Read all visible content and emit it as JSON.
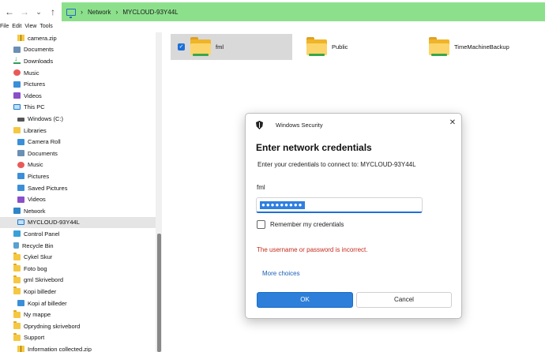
{
  "address": {
    "segments": [
      "Network",
      "MYCLOUD-93Y44L"
    ]
  },
  "menu": [
    "File",
    "Edit",
    "View",
    "Tools"
  ],
  "sidebar": {
    "items": [
      {
        "label": "camera.zip",
        "icon": "zip-icon"
      },
      {
        "label": "Documents",
        "icon": "documents-icon"
      },
      {
        "label": "Downloads",
        "icon": "downloads-icon"
      },
      {
        "label": "Music",
        "icon": "music-icon"
      },
      {
        "label": "Pictures",
        "icon": "pictures-icon"
      },
      {
        "label": "Videos",
        "icon": "videos-icon"
      },
      {
        "label": "This PC",
        "icon": "pc-icon"
      },
      {
        "label": "Windows (C:)",
        "icon": "drive-icon"
      },
      {
        "label": "Libraries",
        "icon": "libraries-icon"
      },
      {
        "label": "Camera Roll",
        "icon": "pictures-icon"
      },
      {
        "label": "Documents",
        "icon": "documents-icon"
      },
      {
        "label": "Music",
        "icon": "music-icon"
      },
      {
        "label": "Pictures",
        "icon": "pictures-icon"
      },
      {
        "label": "Saved Pictures",
        "icon": "pictures-icon"
      },
      {
        "label": "Videos",
        "icon": "videos-icon"
      },
      {
        "label": "Network",
        "icon": "network-icon"
      },
      {
        "label": "MYCLOUD-93Y44L",
        "icon": "pc-icon"
      },
      {
        "label": "Control Panel",
        "icon": "control-panel-icon"
      },
      {
        "label": "Recycle Bin",
        "icon": "recycle-bin-icon"
      },
      {
        "label": "Cykel Skur",
        "icon": "folder-icon"
      },
      {
        "label": "Foto bog",
        "icon": "folder-icon"
      },
      {
        "label": "gml Skrivebord",
        "icon": "folder-icon"
      },
      {
        "label": "Kopi billeder",
        "icon": "folder-icon"
      },
      {
        "label": "Kopi af billeder",
        "icon": "pictures-icon"
      },
      {
        "label": "Ny mappe",
        "icon": "folder-icon"
      },
      {
        "label": "Oprydning skrivebord",
        "icon": "folder-icon"
      },
      {
        "label": "Support",
        "icon": "folder-icon"
      },
      {
        "label": "Information collected.zip",
        "icon": "zip-icon"
      }
    ],
    "selected_index": 16
  },
  "folders": [
    {
      "label": "fml",
      "selected": true
    },
    {
      "label": "Public",
      "selected": false
    },
    {
      "label": "TimeMachineBackup",
      "selected": false
    }
  ],
  "dialog": {
    "title": "Windows Security",
    "heading": "Enter network credentials",
    "subtitle": "Enter your credentials to connect to: MYCLOUD-93Y44L",
    "username": "fml",
    "password_mask": "●●●●●●●●●",
    "remember_label": "Remember my credentials",
    "error": "The username or password is incorrect.",
    "more_choices": "More choices",
    "ok_label": "OK",
    "cancel_label": "Cancel"
  },
  "colors": {
    "address_bg": "#8ce08c",
    "accent": "#2d7fd9",
    "error": "#c42b1c",
    "link": "#1a5fb4"
  }
}
